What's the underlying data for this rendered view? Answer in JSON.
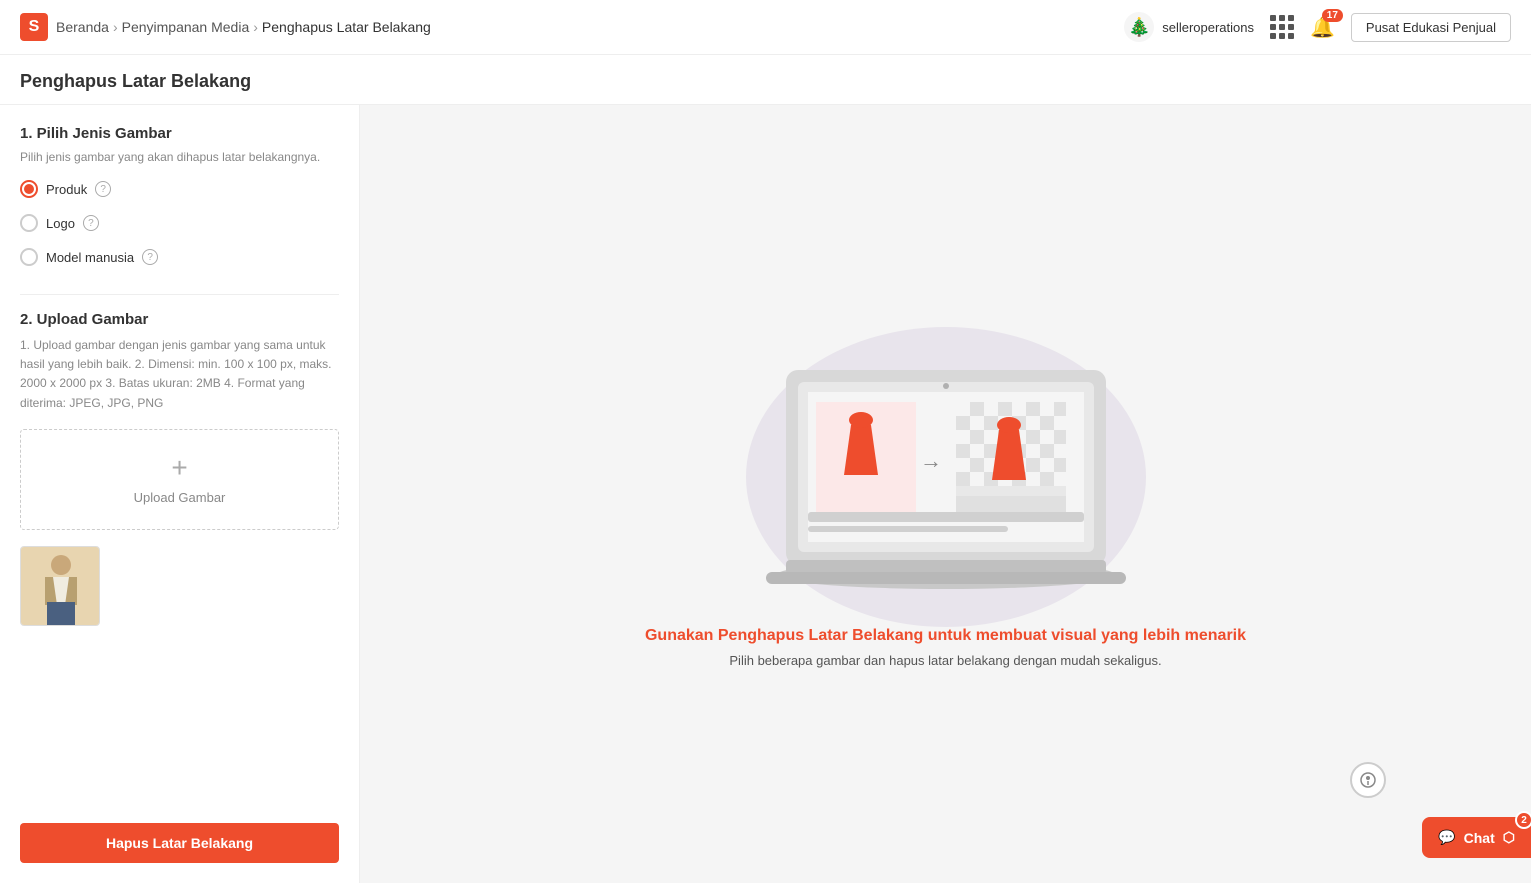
{
  "header": {
    "logo_letter": "S",
    "breadcrumb": {
      "home": "Beranda",
      "media": "Penyimpanan Media",
      "current": "Penghapus Latar Belakang"
    },
    "username": "selleroperations",
    "notif_count": "17",
    "edu_button": "Pusat Edukasi Penjual"
  },
  "page": {
    "title": "Penghapus Latar Belakang"
  },
  "step1": {
    "title": "1. Pilih Jenis Gambar",
    "desc": "Pilih jenis gambar yang akan dihapus latar belakangnya.",
    "options": [
      {
        "id": "produk",
        "label": "Produk",
        "selected": true
      },
      {
        "id": "logo",
        "label": "Logo",
        "selected": false
      },
      {
        "id": "model",
        "label": "Model manusia",
        "selected": false
      }
    ]
  },
  "step2": {
    "title": "2. Upload Gambar",
    "instructions": "1. Upload gambar dengan jenis gambar yang sama untuk hasil yang lebih baik. 2. Dimensi: min. 100 x 100 px, maks. 2000 x 2000 px 3. Batas ukuran: 2MB 4. Format yang diterima: JPEG, JPG, PNG",
    "upload_label": "Upload Gambar"
  },
  "illustration": {
    "promo_title": "Gunakan Penghapus Latar Belakang untuk membuat visual yang lebih menarik",
    "promo_desc": "Pilih beberapa gambar dan hapus latar belakang dengan mudah sekaligus."
  },
  "action": {
    "remove_bg_btn": "Hapus Latar Belakang"
  },
  "chat": {
    "label": "Chat",
    "badge": "2"
  },
  "icons": {
    "help": "?",
    "grid": "grid",
    "bell": "🔔",
    "chat_icon": "💬"
  }
}
